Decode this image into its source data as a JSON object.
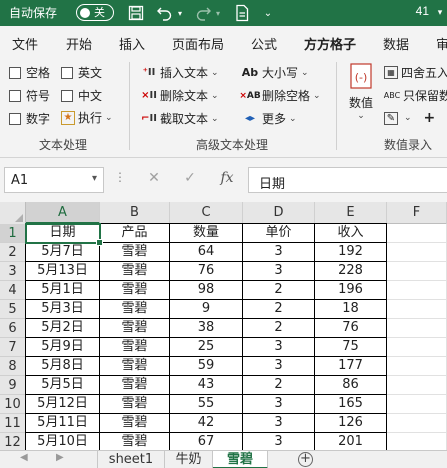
{
  "colors": {
    "accent": "#217346",
    "titlebar_bg": "#217346",
    "ribbon_bg": "#f3f3f3"
  },
  "titlebar": {
    "autosave_label": "自动保存",
    "autosave_state": "关",
    "title": "41",
    "icons": [
      "save-icon",
      "undo-icon",
      "redo-icon",
      "document-icon",
      "more-icon"
    ]
  },
  "tabs": [
    "文件",
    "开始",
    "插入",
    "页面布局",
    "公式",
    "方方格子",
    "数据",
    "审"
  ],
  "active_tab": "方方格子",
  "ribbon": {
    "text_group": {
      "checkboxes": [
        "空格",
        "英文",
        "符号",
        "中文",
        "数字"
      ],
      "execute": "执行",
      "label": "文本处理"
    },
    "advanced_group": {
      "insert_text": "插入文本",
      "delete_text": "删除文本",
      "cut_text": "截取文本",
      "case": "大小写",
      "delete_space": "删除空格",
      "more": "更多",
      "label": "高级文本处理"
    },
    "number_group": {
      "value": "数值",
      "round": "四舍五入",
      "keep": "只保留数",
      "label": "数值录入"
    }
  },
  "formula_bar": {
    "name_box": "A1",
    "cancel_symbol": "✕",
    "enter_symbol": "✓",
    "fx_label": "fx",
    "value": "日期"
  },
  "grid": {
    "columns": [
      "A",
      "B",
      "C",
      "D",
      "E",
      "F"
    ],
    "rows": [
      "1",
      "2",
      "3",
      "4",
      "5",
      "6",
      "7",
      "8",
      "9",
      "10",
      "11",
      "12"
    ],
    "data": [
      [
        "日期",
        "产品",
        "数量",
        "单价",
        "收入"
      ],
      [
        "5月7日",
        "雪碧",
        "64",
        "3",
        "192"
      ],
      [
        "5月13日",
        "雪碧",
        "76",
        "3",
        "228"
      ],
      [
        "5月1日",
        "雪碧",
        "98",
        "2",
        "196"
      ],
      [
        "5月3日",
        "雪碧",
        "9",
        "2",
        "18"
      ],
      [
        "5月2日",
        "雪碧",
        "38",
        "2",
        "76"
      ],
      [
        "5月9日",
        "雪碧",
        "25",
        "3",
        "75"
      ],
      [
        "5月8日",
        "雪碧",
        "59",
        "3",
        "177"
      ],
      [
        "5月5日",
        "雪碧",
        "43",
        "2",
        "86"
      ],
      [
        "5月12日",
        "雪碧",
        "55",
        "3",
        "165"
      ],
      [
        "5月11日",
        "雪碧",
        "42",
        "3",
        "126"
      ],
      [
        "5月10日",
        "雪碧",
        "67",
        "3",
        "201"
      ]
    ],
    "active_cell": "A1"
  },
  "sheets": [
    "sheet1",
    "牛奶",
    "雪碧"
  ],
  "active_sheet": "雪碧"
}
